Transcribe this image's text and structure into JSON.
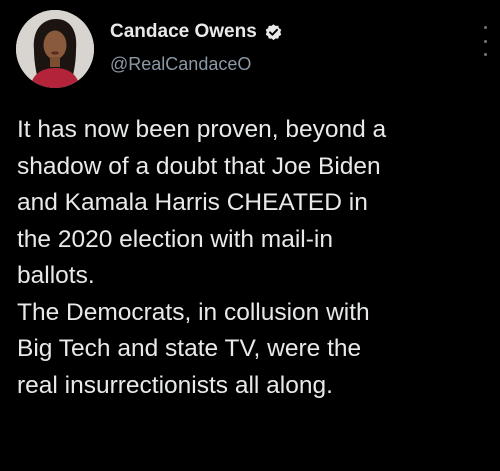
{
  "tweet": {
    "author": {
      "display_name": "Candace Owens",
      "handle": "@RealCandaceO",
      "verified": true
    },
    "body_lines": [
      "It has now been proven, beyond a",
      "shadow of a doubt that Joe Biden",
      "and Kamala Harris CHEATED in",
      "the 2020 election with mail-in",
      "ballots.",
      "The Democrats, in collusion with",
      "Big Tech and state TV, were the",
      "real insurrectionists all along."
    ]
  },
  "icons": {
    "verified": "verified-badge-icon",
    "more": "more-options-icon"
  },
  "colors": {
    "background": "#000000",
    "text_primary": "#e7e9ea",
    "text_secondary": "#8b98a5",
    "verified_badge": "#e7e9ea"
  }
}
